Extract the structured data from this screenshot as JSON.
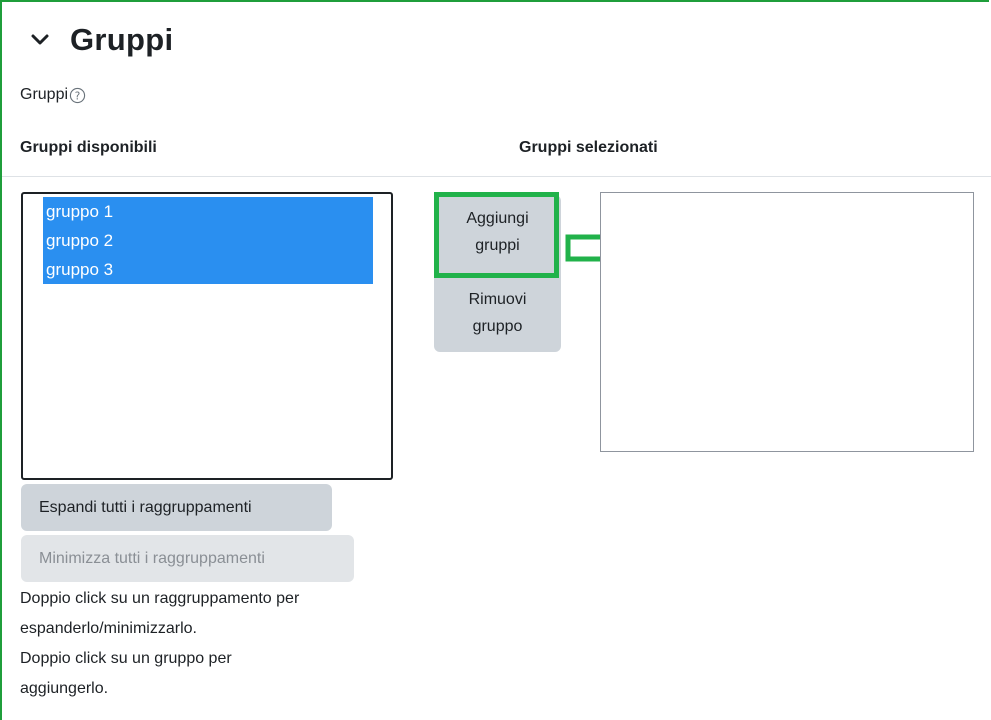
{
  "section": {
    "title": "Gruppi",
    "field_label": "Gruppi"
  },
  "columns": {
    "available": "Gruppi disponibili",
    "selected": "Gruppi selezionati"
  },
  "available_list": {
    "options": [
      "gruppo 1",
      "gruppo 2",
      "gruppo 3"
    ]
  },
  "selected_list": {
    "options": []
  },
  "buttons": {
    "add_line1": "Aggiungi",
    "add_line2": "gruppi",
    "remove_line1": "Rimuovi",
    "remove_line2": "gruppo",
    "expand_all": "Espandi tutti i raggruppamenti",
    "collapse_all": "Minimizza tutti i raggruppamenti"
  },
  "hints": {
    "line1": "Doppio click su un raggruppamento per",
    "line2": "espanderlo/minimizzarlo.",
    "line3": "Doppio click su un gruppo per",
    "line4": "aggiungerlo."
  },
  "colors": {
    "highlight": "#21b24a",
    "selection": "#2a8ff0",
    "button": "#ced4da"
  },
  "icons": [
    "chevron-down-icon",
    "help-icon",
    "arrow-right-icon"
  ]
}
